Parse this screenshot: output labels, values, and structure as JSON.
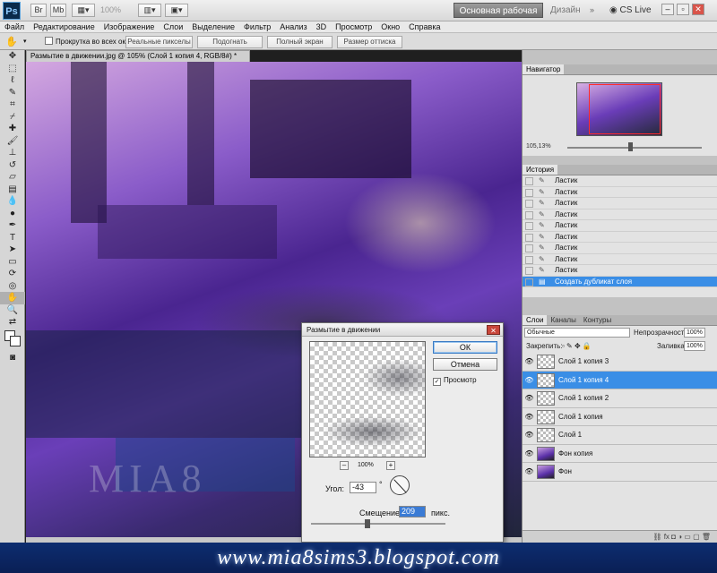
{
  "app": {
    "logo": "Ps",
    "zoom_level": "100%",
    "workspace": "Основная рабочая среда",
    "design": "Дизайн",
    "cs_live": "CS Live"
  },
  "menu": [
    "Файл",
    "Редактирование",
    "Изображение",
    "Слои",
    "Выделение",
    "Фильтр",
    "Анализ",
    "3D",
    "Просмотр",
    "Окно",
    "Справка"
  ],
  "options": {
    "scroll_all": "Прокрутка во всех окнах",
    "actual_pixels": "Реальные пикселы",
    "fit_screen": "Подогнать",
    "full_screen": "Полный экран",
    "print_size": "Размер оттиска"
  },
  "document": {
    "tab": "Размытие в движении.jpg @ 105% (Слой 1 копия 4, RGB/8#) *",
    "watermark": "MIA8"
  },
  "navigator": {
    "tab": "Навигатор",
    "zoom": "105,13%"
  },
  "history": {
    "tab": "История",
    "items": [
      "Ластик",
      "Ластик",
      "Ластик",
      "Ластик",
      "Ластик",
      "Ластик",
      "Ластик",
      "Ластик",
      "Ластик",
      "Создать дубликат слоя"
    ],
    "active_index": 9
  },
  "layers": {
    "tabs": [
      "Слои",
      "Каналы",
      "Контуры"
    ],
    "blend_mode": "Обычные",
    "opacity_label": "Непрозрачность:",
    "opacity": "100%",
    "lock_label": "Закрепить:",
    "fill_label": "Заливка:",
    "fill": "100%",
    "items": [
      "Слой 1 копия 3",
      "Слой 1 копия 4",
      "Слой 1 копия 2",
      "Слой 1 копия",
      "Слой 1",
      "Фон копия",
      "Фон"
    ],
    "active_index": 1
  },
  "dialog": {
    "title": "Размытие в движении",
    "ok": "ОК",
    "cancel": "Отмена",
    "preview": "Просмотр",
    "zoom": "100%",
    "angle_label": "Угол:",
    "angle": "-43",
    "angle_unit": "°",
    "distance_label": "Смещение:",
    "distance": "209",
    "distance_unit": "пикс.",
    "distance_fraction": 0.42
  },
  "banner": "www.mia8sims3.blogspot.com",
  "icons": [
    "hand-icon",
    "move-icon",
    "marquee-icon",
    "lasso-icon",
    "quick-select-icon",
    "crop-icon",
    "eyedropper-icon",
    "heal-icon",
    "brush-icon",
    "stamp-icon",
    "history-brush-icon",
    "eraser-icon",
    "gradient-icon",
    "blur-icon",
    "dodge-icon",
    "pen-icon",
    "type-icon",
    "path-select-icon",
    "shape-icon",
    "3d-rotate-icon",
    "3d-orbit-icon",
    "hand-tool-icon",
    "zoom-icon"
  ]
}
